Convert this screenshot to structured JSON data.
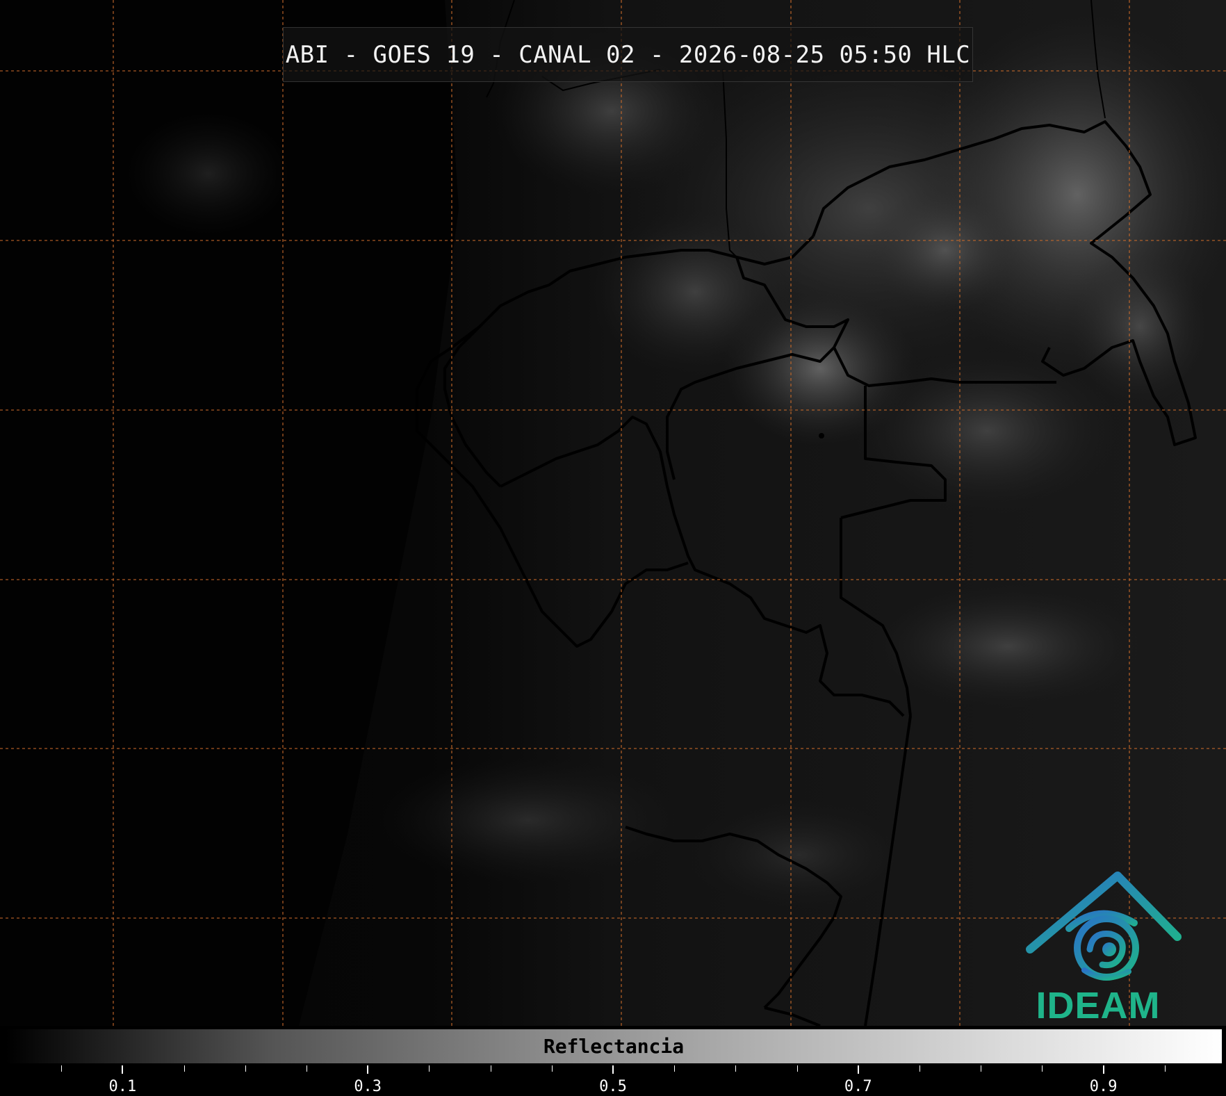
{
  "title": "ABI - GOES 19 - CANAL 02 - 2026-08-25 05:50 HLC",
  "logo": {
    "text": "IDEAM",
    "icon": "ideam-eye-roof-icon",
    "colors": {
      "blue": "#2a72c8",
      "teal": "#1fb48a"
    }
  },
  "colorbar": {
    "label": "Reflectancia",
    "range": [
      0,
      1
    ],
    "major_ticks": [
      {
        "value": 0.1,
        "label": "0.1"
      },
      {
        "value": 0.3,
        "label": "0.3"
      },
      {
        "value": 0.5,
        "label": "0.5"
      },
      {
        "value": 0.7,
        "label": "0.7"
      },
      {
        "value": 0.9,
        "label": "0.9"
      }
    ],
    "minor_step": 0.05,
    "colors": {
      "low": "#000000",
      "high": "#ffffff"
    }
  },
  "map": {
    "gridline_color": "#c86a2a",
    "background_color": "#000000",
    "border_color": "#000000"
  }
}
